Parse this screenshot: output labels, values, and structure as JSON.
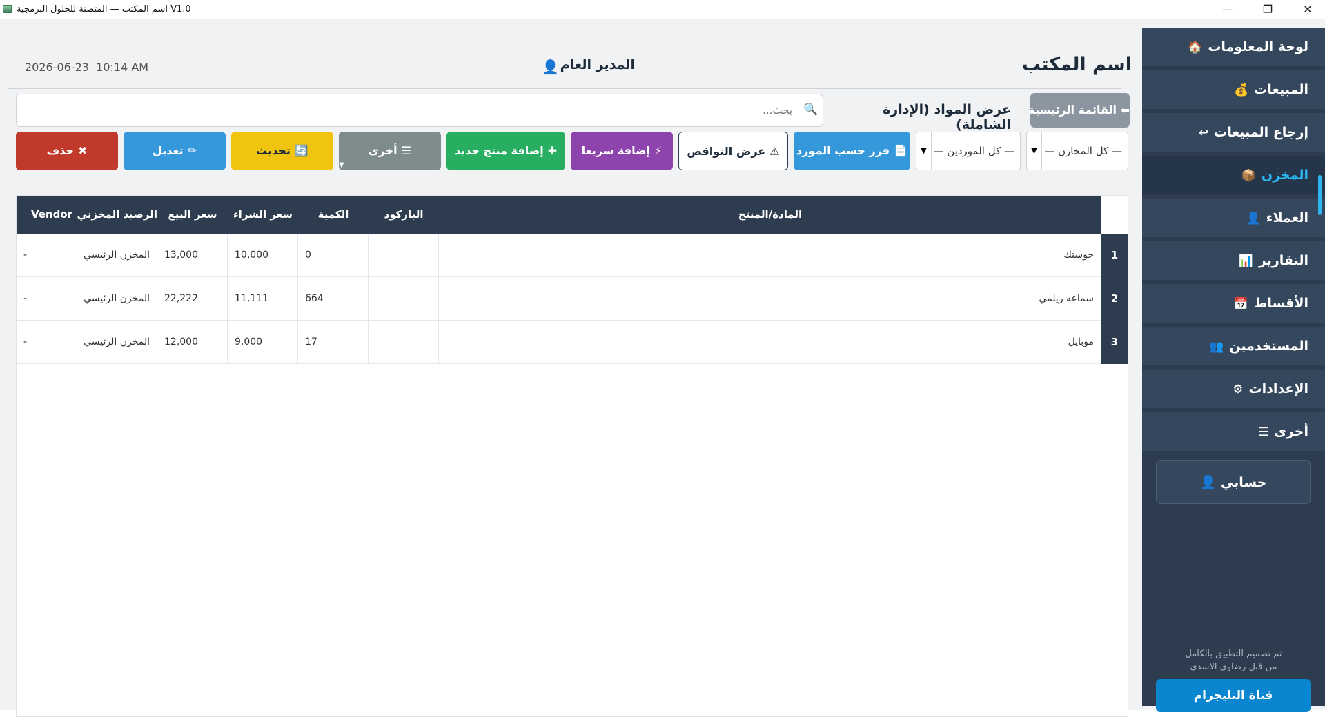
{
  "window": {
    "title": "V1.0 اسم المكتب — المتصنة للحلول البرمجية",
    "controls": {
      "minimize": "—",
      "restore": "❐",
      "close": "✕"
    }
  },
  "sidebar": {
    "items": [
      {
        "label": "لوحة المعلومات",
        "icon": "house-icon",
        "glyph": "🏠"
      },
      {
        "label": "المبيعات",
        "icon": "money-bag-icon",
        "glyph": "💰"
      },
      {
        "label": "إرجاع المبيعات",
        "icon": "return-arrow-icon",
        "glyph": "↩"
      },
      {
        "label": "المخزن",
        "icon": "package-icon",
        "glyph": "📦",
        "active": true
      },
      {
        "label": "العملاء",
        "icon": "user-icon",
        "glyph": "👤"
      },
      {
        "label": "التقارير",
        "icon": "bar-chart-icon",
        "glyph": "📊"
      },
      {
        "label": "الأقساط",
        "icon": "calendar-icon",
        "glyph": "📅"
      },
      {
        "label": "المستخدمين",
        "icon": "users-icon",
        "glyph": "👥"
      },
      {
        "label": "الإعدادات",
        "icon": "gear-icon",
        "glyph": "⚙"
      },
      {
        "label": "أخرى",
        "icon": "menu-icon",
        "glyph": "☰"
      }
    ],
    "account_label": "حسابي",
    "account_glyph": "👤",
    "credit_line1": "تم تصميم التطبيق بالكامل",
    "credit_line2": "من قبل رضاوي الاسدي",
    "telegram_label": "قناة التليجرام"
  },
  "header": {
    "office_name": "اسم المكتب",
    "user_role": "المدير العام",
    "user_glyph": "👤",
    "date": "2026-06-23",
    "time": "10:14 AM"
  },
  "search": {
    "placeholder": "بحث...",
    "value": "",
    "glyph": "🔍"
  },
  "view_title": "عرض المواد (الإدارة الشاملة)",
  "main_menu_button": {
    "label": "القائمة الرئيسية",
    "glyph": "⬅"
  },
  "toolbar": {
    "delete": {
      "label": "حذف",
      "glyph": "✖"
    },
    "edit": {
      "label": "تعديل",
      "glyph": "✏"
    },
    "refresh": {
      "label": "تحديث",
      "glyph": "🔄"
    },
    "other": {
      "label": "أخرى",
      "glyph": "☰"
    },
    "add_new": {
      "label": "إضافة منتج جديد",
      "glyph": "✚"
    },
    "quick_add": {
      "label": "إضافة سريعا",
      "glyph": "⚡"
    },
    "shortages": {
      "label": "عرض النواقص",
      "glyph": "⚠"
    },
    "sort_vendor": {
      "label": "فرز حسب المورد",
      "glyph": "📄"
    }
  },
  "filters": {
    "vendors": {
      "value": "— كل الموردين —"
    },
    "stores": {
      "value": "— كل المخازن —"
    }
  },
  "table": {
    "columns": [
      "المادة/المنتج",
      "الباركود",
      "الكمية",
      "سعر الشراء",
      "سعر البيع",
      "الرصيد المخزني",
      "Vendor"
    ],
    "rows": [
      {
        "num": "1",
        "product": "جوستك",
        "barcode": "",
        "qty": "0",
        "buy": "10,000",
        "sell": "13,000",
        "store": "المخزن الرئيسي",
        "vendor": "-"
      },
      {
        "num": "2",
        "product": "سماعه ريلمي",
        "barcode": "",
        "qty": "664",
        "buy": "11,111",
        "sell": "22,222",
        "store": "المخزن الرئيسي",
        "vendor": "-"
      },
      {
        "num": "3",
        "product": "موبايل",
        "barcode": "",
        "qty": "17",
        "buy": "9,000",
        "sell": "12,000",
        "store": "المخزن الرئيسي",
        "vendor": "-"
      }
    ]
  },
  "colors": {
    "sidebar_bg": "#2d3c4e",
    "accent": "#2bb6f0",
    "delete": "#c0392b",
    "edit": "#3498db",
    "refresh": "#f1c40f",
    "other": "#7f8c8d",
    "add_new": "#27ae60",
    "quick_add": "#8e44ad",
    "telegram": "#0a86d0"
  }
}
